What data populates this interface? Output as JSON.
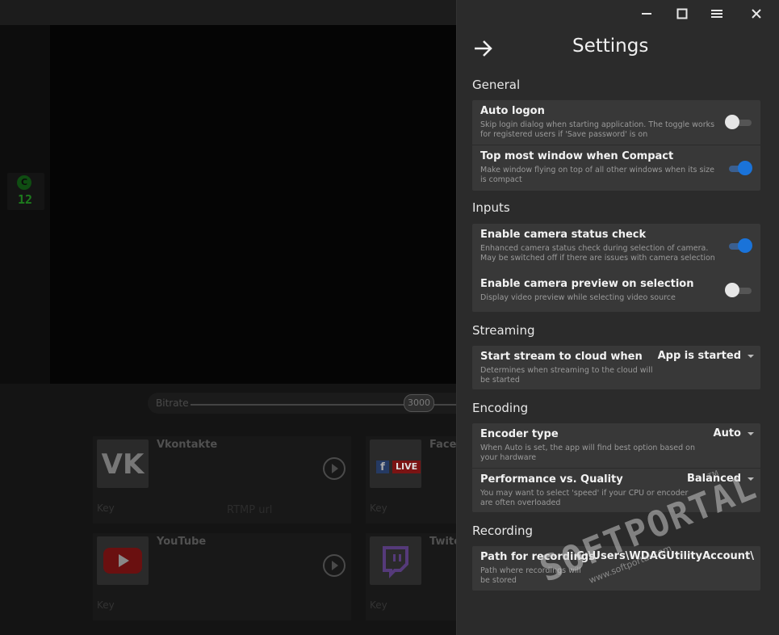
{
  "background": {
    "camera_badge": {
      "letter": "C",
      "count": "12"
    },
    "bitrate": {
      "label": "Bitrate",
      "value": "3000"
    },
    "services": [
      {
        "name": "Vkontakte",
        "key_label": "Key",
        "extra": "RTMP url",
        "icon": "vk-logo"
      },
      {
        "name": "Faceb",
        "key_label": "Key",
        "live": "LIVE",
        "icon": "facebook-live-logo"
      },
      {
        "name": "YouTube",
        "key_label": "Key",
        "icon": "youtube-logo"
      },
      {
        "name": "Twitc",
        "key_label": "Key",
        "icon": "twitch-logo"
      }
    ]
  },
  "window_controls": {
    "minimize": "minimize-icon",
    "maximize": "maximize-icon",
    "menu": "menu-icon",
    "close": "close-icon"
  },
  "settings": {
    "title": "Settings",
    "sections": {
      "general": {
        "title": "General",
        "auto_logon": {
          "title": "Auto logon",
          "desc": "Skip login dialog when starting application. The toggle works for registered users if 'Save password' is on",
          "on": false
        },
        "top_most": {
          "title": "Top most window when Compact",
          "desc": "Make window flying on top of all other windows when its size is compact",
          "on": true
        }
      },
      "inputs": {
        "title": "Inputs",
        "camera_check": {
          "title": "Enable camera status check",
          "desc": "Enhanced camera status check during selection of camera. May be switched off if there are issues with camera selection",
          "on": true
        },
        "camera_preview": {
          "title": "Enable camera preview on selection",
          "desc": "Display video preview while selecting video source",
          "on": false
        }
      },
      "streaming": {
        "title": "Streaming",
        "start_stream": {
          "title": "Start stream to cloud when",
          "desc": "Determines when streaming to the cloud will be started",
          "value": "App is started"
        }
      },
      "encoding": {
        "title": "Encoding",
        "encoder_type": {
          "title": "Encoder type",
          "desc": "When Auto is set, the app will find best option based on your hardware",
          "value": "Auto"
        },
        "perf_quality": {
          "title": "Performance vs. Quality",
          "desc": "You may want to select 'speed' if your CPU or encoder are often overloaded",
          "value": "Balanced"
        }
      },
      "recording": {
        "title": "Recording",
        "path": {
          "title": "Path for recordings",
          "desc": "Path where recordings will be stored",
          "value": "C:\\Users\\WDAGUtilityAccount\\"
        }
      }
    }
  },
  "watermark": {
    "main": "SOFTPORTAL",
    "url": "www.softportal.com",
    "tm": "TM"
  },
  "colors": {
    "accent": "#1a73d9",
    "panel_bg": "#2b2b2b",
    "card_bg": "#383838"
  }
}
